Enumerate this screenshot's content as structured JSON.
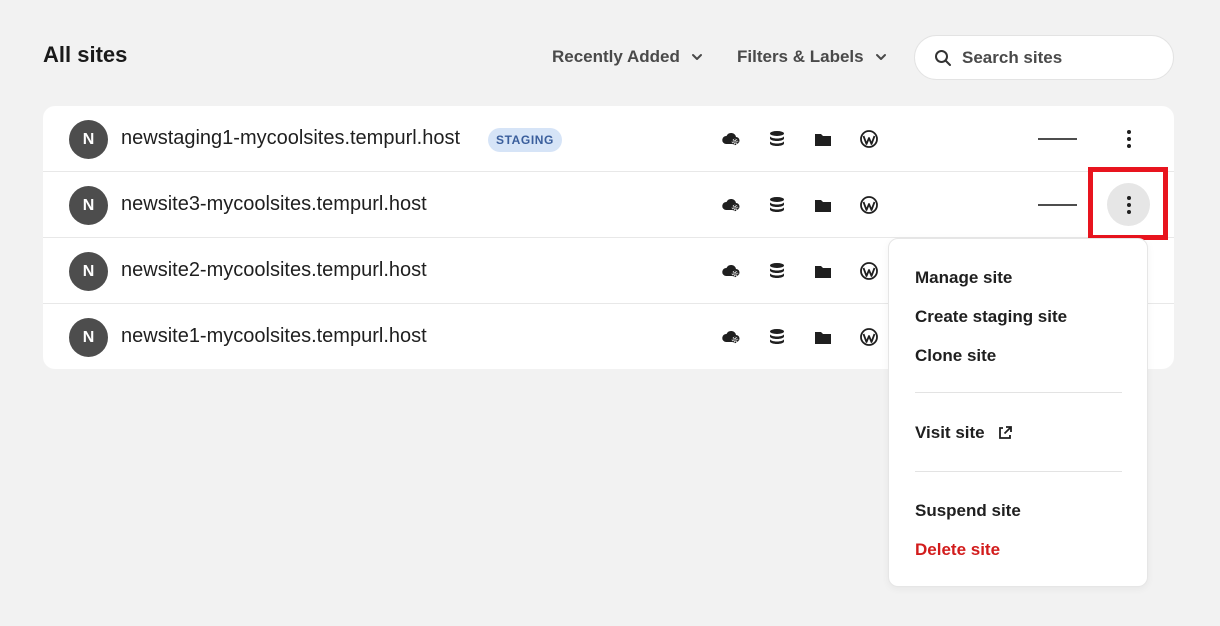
{
  "header": {
    "title": "All sites",
    "sort_label": "Recently Added",
    "filter_label": "Filters & Labels",
    "search_placeholder": "Search sites"
  },
  "sites": [
    {
      "initial": "N",
      "name": "newstaging1-mycoolsites.tempurl.host",
      "badge": "STAGING",
      "status": "—"
    },
    {
      "initial": "N",
      "name": "newsite3-mycoolsites.tempurl.host",
      "badge": "",
      "status": "—"
    },
    {
      "initial": "N",
      "name": "newsite2-mycoolsites.tempurl.host",
      "badge": "",
      "status": ""
    },
    {
      "initial": "N",
      "name": "newsite1-mycoolsites.tempurl.host",
      "badge": "",
      "status": ""
    }
  ],
  "row_icons": [
    "cloud-gear-icon",
    "database-icon",
    "folder-icon",
    "wordpress-icon"
  ],
  "menu": {
    "manage": "Manage site",
    "create_staging": "Create staging site",
    "clone": "Clone site",
    "visit": "Visit site",
    "suspend": "Suspend site",
    "delete": "Delete site"
  },
  "colors": {
    "avatar": "#4d4d4d",
    "badge_bg": "#d6e4f7",
    "badge_text": "#3a5e9c",
    "danger": "#d21c1c",
    "highlight": "#e8141e"
  }
}
